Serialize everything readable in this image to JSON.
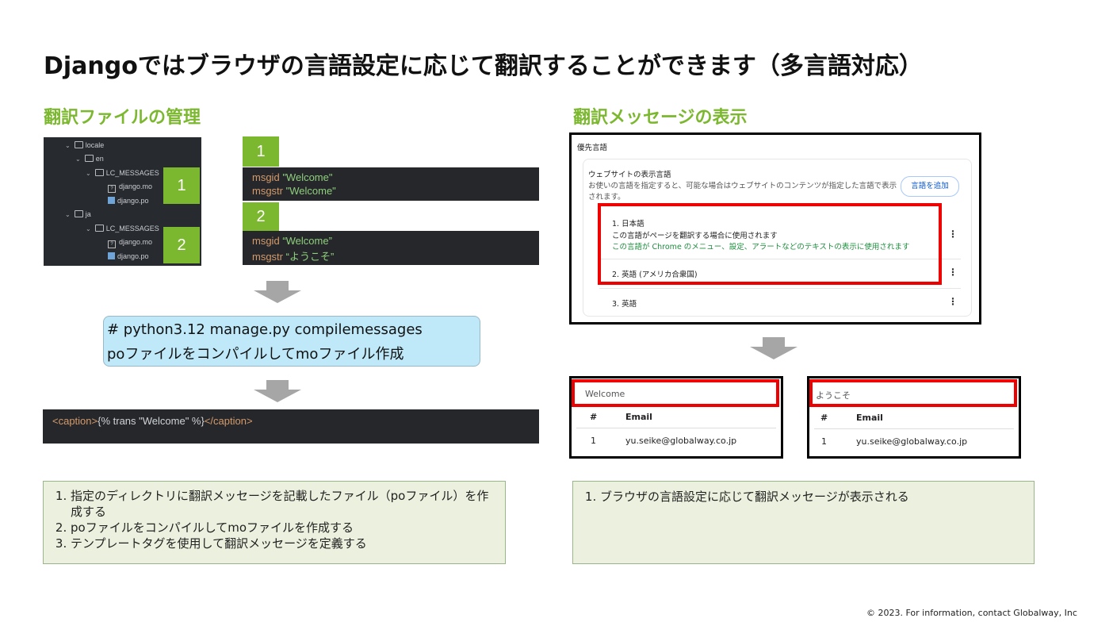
{
  "title": "Djangoではブラウザの言語設定に応じて翻訳することができます（多言語対応）",
  "left_section": {
    "heading": "翻訳ファイルの管理",
    "tree": {
      "items": [
        {
          "label": "locale"
        },
        {
          "label": "en"
        },
        {
          "label": "LC_MESSAGES"
        },
        {
          "label": "django.mo"
        },
        {
          "label": "django.po"
        },
        {
          "label": "ja"
        },
        {
          "label": "LC_MESSAGES"
        },
        {
          "label": "django.mo"
        },
        {
          "label": "django.po"
        }
      ]
    },
    "badge1": "1",
    "badge2": "2",
    "code1": {
      "msgid_kw": "msgid",
      "msgid_val": "\"Welcome\"",
      "msgstr_kw": "msgstr",
      "msgstr_val": "\"Welcome\""
    },
    "code2": {
      "msgid_kw": "msgid",
      "msgid_val": "“Welcome”",
      "msgstr_kw": "msgstr",
      "msgstr_val": "“ようこそ”"
    },
    "command": {
      "line1": "# python3.12 manage.py compilemessages",
      "line2": "poファイルをコンパイルしてmoファイル作成"
    },
    "template_code": {
      "open": "<caption>",
      "tag": "{% trans \"Welcome\" %}",
      "close": "</caption>"
    },
    "steps": [
      "指定のディレクトリに翻訳メッセージを記載したファイル（poファイル）を作成する",
      "poファイルをコンパイルしてmoファイルを作成する",
      "テンプレートタグを使用して翻訳メッセージを定義する"
    ]
  },
  "right_section": {
    "heading": "翻訳メッセージの表示",
    "settings": {
      "header": "優先言語",
      "subtitle": "ウェブサイトの表示言語",
      "description_line1": "お使いの言語を指定すると、可能な場合はウェブサイトのコンテンツが指定した言語で表示",
      "description_line2": "されます。",
      "add_button": "言語を追加",
      "languages": [
        {
          "label": "1. 日本語",
          "note1": "この言語がページを翻訳する場合に使用されます",
          "note2": "この言語が Chrome のメニュー、設定、アラートなどのテキストの表示に使用されます"
        },
        {
          "label": "2. 英語 (アメリカ合衆国)"
        },
        {
          "label": "3. 英語"
        }
      ],
      "kebab": "⋮"
    },
    "table_en": {
      "caption": "Welcome",
      "col1": "#",
      "col2": "Email",
      "row_no": "1",
      "row_email": "yu.seike@globalway.co.jp"
    },
    "table_ja": {
      "caption": "ようこそ",
      "col1": "#",
      "col2": "Email",
      "row_no": "1",
      "row_email": "yu.seike@globalway.co.jp"
    },
    "steps": [
      "ブラウザの言語設定に応じて翻訳メッセージが表示される"
    ]
  },
  "colors": {
    "accent": "#7cb82f",
    "highlight_red": "#ee0000",
    "note_bg": "#ebf1de",
    "cmd_bg": "#bfe8f8"
  },
  "footer": "© 2023. For information, contact Globalway, Inc"
}
